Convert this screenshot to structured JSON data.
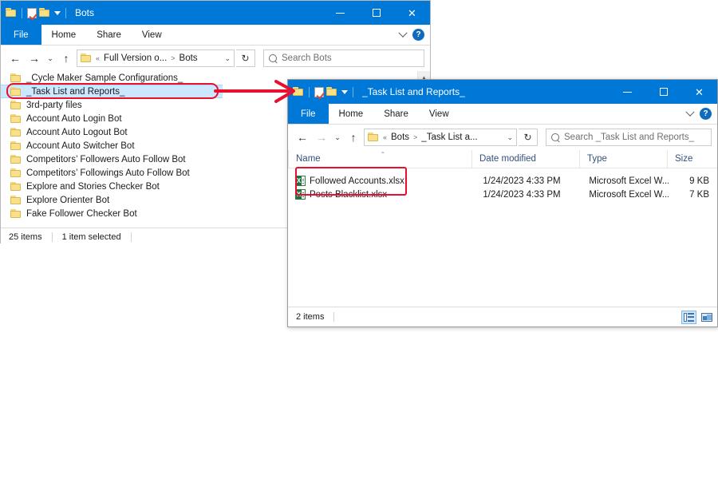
{
  "window1": {
    "title": "Bots",
    "quick_access": [
      "folder-icon",
      "properties-checkmark-icon",
      "new-folder-icon",
      "customize-dropdown-icon"
    ],
    "controls": {
      "minimize": "–",
      "maximize": "□",
      "close": "✕"
    },
    "ribbon": {
      "tabs": [
        "File",
        "Home",
        "Share",
        "View"
      ],
      "collapse": "chevron-down-icon",
      "help": "?"
    },
    "nav": {
      "back": "←",
      "forward": "→",
      "recent": "⌄",
      "up": "↑",
      "breadcrumb": [
        "«",
        "Full Version o...",
        ">",
        "Bots"
      ],
      "dropdown": "⌄",
      "refresh": "↻"
    },
    "search": {
      "placeholder": "Search Bots"
    },
    "items": [
      {
        "name": "_Cycle Maker Sample Configurations_",
        "selected": false
      },
      {
        "name": "_Task List and Reports_",
        "selected": true
      },
      {
        "name": "3rd-party files",
        "selected": false
      },
      {
        "name": "Account Auto Login Bot",
        "selected": false
      },
      {
        "name": "Account Auto Logout Bot",
        "selected": false
      },
      {
        "name": "Account Auto Switcher Bot",
        "selected": false
      },
      {
        "name": "Competitors’ Followers Auto Follow Bot",
        "selected": false
      },
      {
        "name": "Competitors’ Followings Auto Follow Bot",
        "selected": false
      },
      {
        "name": "Explore and Stories Checker Bot",
        "selected": false
      },
      {
        "name": "Explore Orienter Bot",
        "selected": false
      },
      {
        "name": "Fake Follower Checker Bot",
        "selected": false
      }
    ],
    "status": {
      "count": "25 items",
      "selection": "1 item selected"
    }
  },
  "window2": {
    "title": "_Task List and Reports_",
    "quick_access": [
      "folder-icon",
      "properties-checkmark-icon",
      "new-folder-icon",
      "customize-dropdown-icon"
    ],
    "controls": {
      "minimize": "–",
      "maximize": "□",
      "close": "✕"
    },
    "ribbon": {
      "tabs": [
        "File",
        "Home",
        "Share",
        "View"
      ],
      "collapse": "chevron-down-icon",
      "help": "?"
    },
    "nav": {
      "back": "←",
      "forward": "→",
      "recent": "⌄",
      "up": "↑",
      "breadcrumb": [
        "«",
        "Bots",
        ">",
        "_Task List a..."
      ],
      "dropdown": "⌄",
      "refresh": "↻"
    },
    "search": {
      "placeholder": "Search _Task List and Reports_"
    },
    "columns": [
      "Name",
      "Date modified",
      "Type",
      "Size"
    ],
    "sort_indicator": "⌃",
    "rows": [
      {
        "name": "Followed Accounts.xlsx",
        "date_modified": "1/24/2023 4:33 PM",
        "type": "Microsoft Excel W...",
        "size": "9 KB",
        "icon": "excel-file-icon"
      },
      {
        "name": "Posts Blacklist.xlsx",
        "date_modified": "1/24/2023 4:33 PM",
        "type": "Microsoft Excel W...",
        "size": "7 KB",
        "icon": "excel-file-icon"
      }
    ],
    "status": {
      "count": "2 items"
    },
    "view_buttons": [
      "details-view-icon",
      "large-icons-view-icon"
    ]
  },
  "annotations": {
    "highlight_color": "#e8112d",
    "arrow_label": "red-arrow-pointing-right",
    "selected_folder_highlight": "_Task List and Reports_",
    "files_highlight": "excel-files-group"
  },
  "colors": {
    "title_bar": "#0078d7",
    "selection": "#cce8ff",
    "annotation": "#e8112d",
    "excel_green": "#1d6f42"
  }
}
